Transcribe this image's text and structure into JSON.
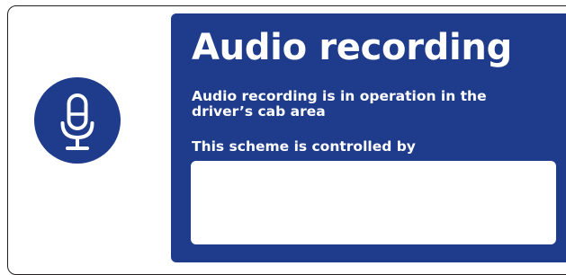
{
  "sign": {
    "title": "Audio recording",
    "operation_text": "Audio recording is in operation in the driver’s cab area",
    "controlled_label": "This scheme is controlled by",
    "controller_value": "",
    "icon": "microphone-icon",
    "colors": {
      "panel": "#1f3c8c",
      "text": "#ffffff",
      "background": "#ffffff",
      "border": "#231f20"
    }
  }
}
